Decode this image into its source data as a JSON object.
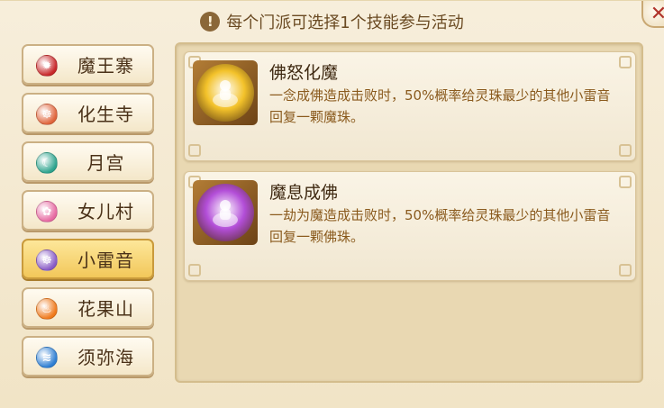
{
  "header": {
    "notice_text": "每个门派可选择1个技能参与活动",
    "close_glyph": "✕",
    "warn_glyph": "!"
  },
  "sects": [
    {
      "label": "魔王寨",
      "icon": "demon-fire-emblem",
      "color": "#c8282a",
      "glyph": "✹",
      "selected": false
    },
    {
      "label": "化生寺",
      "icon": "buddha-temple-emblem",
      "color": "#e0653c",
      "glyph": "☸",
      "selected": false
    },
    {
      "label": "月宫",
      "icon": "moon-palace-emblem",
      "color": "#2fa48e",
      "glyph": "☾",
      "selected": false
    },
    {
      "label": "女儿村",
      "icon": "flower-village-emblem",
      "color": "#e76aa2",
      "glyph": "✿",
      "selected": false
    },
    {
      "label": "小雷音",
      "icon": "thunder-temple-emblem",
      "color": "#8a5cc6",
      "glyph": "☸",
      "selected": true
    },
    {
      "label": "花果山",
      "icon": "mountain-emblem",
      "color": "#f07a1c",
      "glyph": "♨",
      "selected": false
    },
    {
      "label": "须弥海",
      "icon": "sea-emblem",
      "color": "#2f7fd3",
      "glyph": "≋",
      "selected": false
    }
  ],
  "skills": [
    {
      "name": "佛怒化魔",
      "description": "一念成佛造成击败时，50%概率给灵珠最少的其他小雷音回复一颗魔珠。",
      "icon": "golden-buddha-skill-icon",
      "icon_color": "#f3c22a"
    },
    {
      "name": "魔息成佛",
      "description": "一劫为魔造成击败时，50%概率给灵珠最少的其他小雷音回复一颗佛珠。",
      "icon": "purple-buddha-skill-icon",
      "icon_color": "#b34ed8"
    }
  ]
}
